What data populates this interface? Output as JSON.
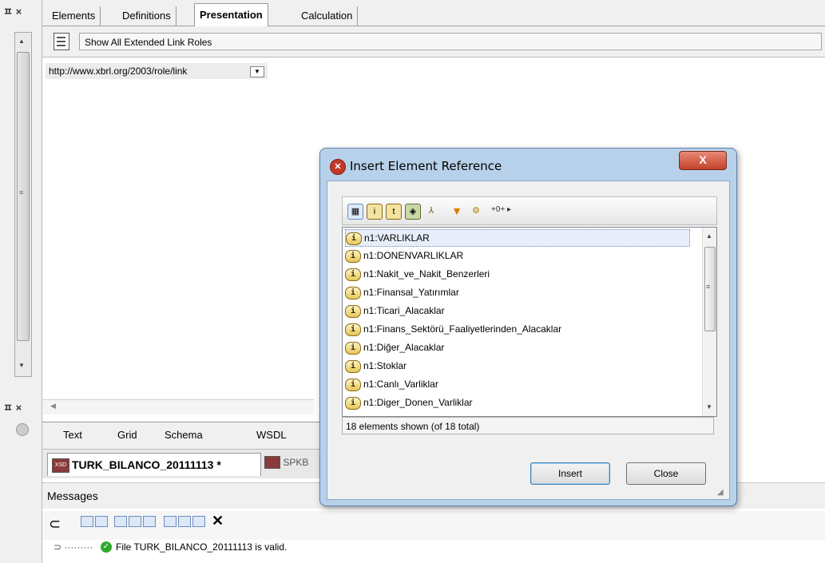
{
  "left_pane": {
    "pin_x_top": "ㅍ ×",
    "pin_x_mid": "ㅍ ×",
    "grip": "≡"
  },
  "tabs": [
    "Elements",
    "Definitions",
    "Presentation",
    "Calculation"
  ],
  "active_tab": "Presentation",
  "toolbar": {
    "show_roles_label": "Show All Extended Link Roles"
  },
  "role_select": {
    "value": "http://www.xbrl.org/2003/role/link"
  },
  "view_tabs": [
    "Text",
    "Grid",
    "Schema",
    "WSDL"
  ],
  "doc_tabs": {
    "active": "TURK_BILANCO_20111113 *",
    "other": "SPKB"
  },
  "messages": {
    "title": "Messages",
    "line": "File TURK_BILANCO_20111113 is valid."
  },
  "dialog": {
    "title": "Insert Element Reference",
    "close_symbol": "X",
    "extra_button": "+0+ ▸",
    "items": [
      "n1:VARLIKLAR",
      "n1:DONENVARLIKLAR",
      "n1:Nakit_ve_Nakit_Benzerleri",
      "n1:Finansal_Yatırımlar",
      "n1:Ticari_Alacaklar",
      "n1:Finans_Sektörü_Faaliyetlerinden_Alacaklar",
      "n1:Diğer_Alacaklar",
      "n1:Stoklar",
      "n1:Canlı_Varliklar",
      "n1:Diger_Donen_Varliklar"
    ],
    "selected_index": 0,
    "status": "18 elements shown (of 18 total)",
    "insert_label": "Insert",
    "close_label": "Close"
  },
  "colors": {
    "dialog_frame": "#b8d1ea",
    "close_button": "#c4412b",
    "valid_check": "#2fa82f"
  }
}
